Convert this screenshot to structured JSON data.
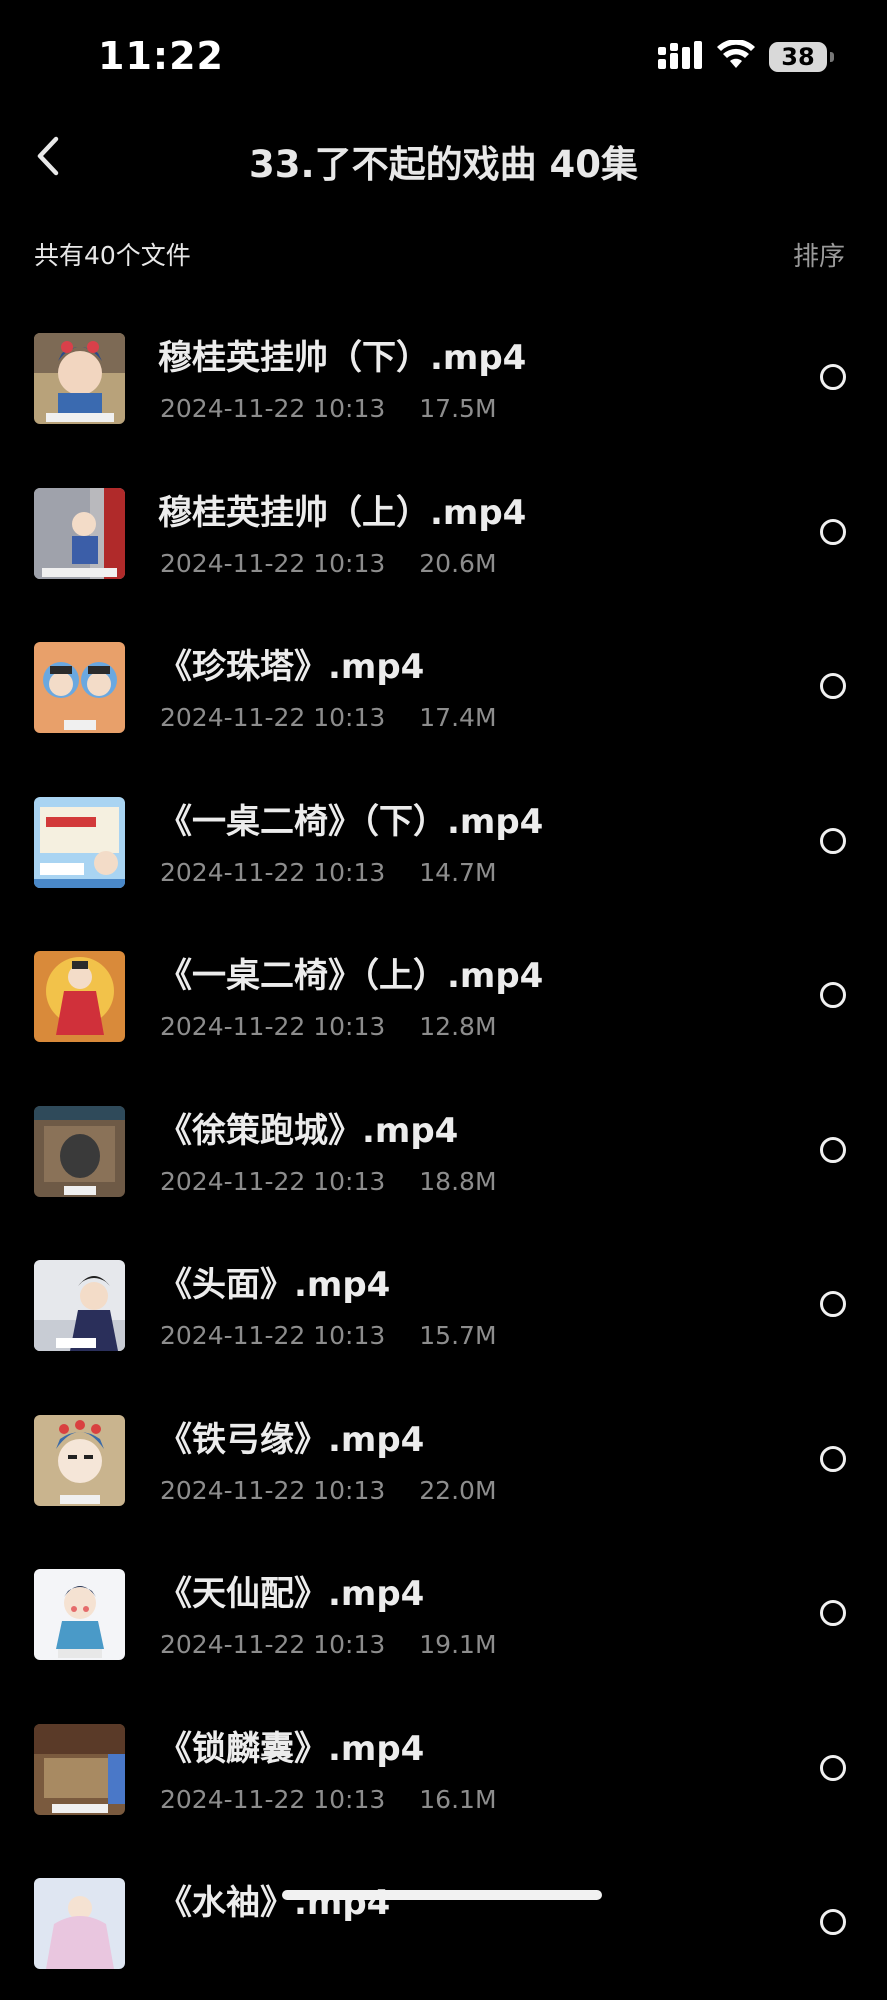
{
  "status_bar": {
    "time": "11:22",
    "battery": "38",
    "icons": [
      "cellular-signal-icon",
      "wifi-icon",
      "battery-icon"
    ]
  },
  "nav": {
    "title": "33.了不起的戏曲 40集",
    "back_icon": "chevron-left-icon"
  },
  "summary": {
    "count_text": "共有40个文件",
    "sort_label": "排序"
  },
  "files": [
    {
      "name": "穆桂英挂帅（下）.mp4",
      "date": "2024-11-22 10:13",
      "size": "17.5M"
    },
    {
      "name": "穆桂英挂帅（上）.mp4",
      "date": "2024-11-22 10:13",
      "size": "20.6M"
    },
    {
      "name": "《珍珠塔》.mp4",
      "date": "2024-11-22 10:13",
      "size": "17.4M"
    },
    {
      "name": "《一桌二椅》（下）.mp4",
      "date": "2024-11-22 10:13",
      "size": "14.7M"
    },
    {
      "name": "《一桌二椅》（上）.mp4",
      "date": "2024-11-22 10:13",
      "size": "12.8M"
    },
    {
      "name": "《徐策跑城》.mp4",
      "date": "2024-11-22 10:13",
      "size": "18.8M"
    },
    {
      "name": "《头面》.mp4",
      "date": "2024-11-22 10:13",
      "size": "15.7M"
    },
    {
      "name": "《铁弓缘》.mp4",
      "date": "2024-11-22 10:13",
      "size": "22.0M"
    },
    {
      "name": "《天仙配》.mp4",
      "date": "2024-11-22 10:13",
      "size": "19.1M"
    },
    {
      "name": "《锁麟囊》.mp4",
      "date": "2024-11-22 10:13",
      "size": "16.1M"
    },
    {
      "name": "《水袖》.mp4",
      "date": "",
      "size": ""
    }
  ],
  "colors": {
    "background": "#000000",
    "primary_text": "#ececec",
    "secondary_text": "#8d8d8d",
    "sort_text": "#9a9a9a"
  }
}
